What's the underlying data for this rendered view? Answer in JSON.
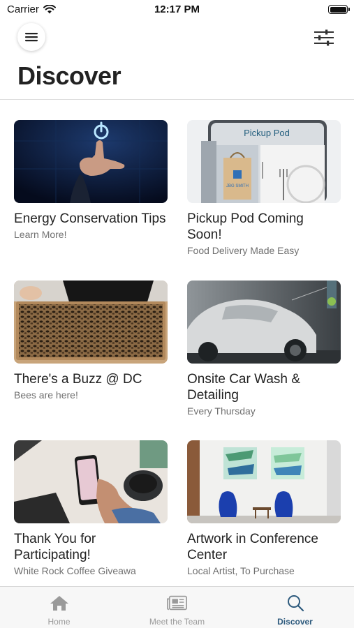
{
  "status_bar": {
    "carrier": "Carrier",
    "time": "12:17 PM"
  },
  "header": {
    "title": "Discover",
    "menu_icon": "hamburger-menu-icon",
    "filter_icon": "sliders-icon"
  },
  "cards": [
    {
      "title": "Energy Conservation Tips",
      "subtitle": "Learn More!",
      "image": "hand-touching-power-button"
    },
    {
      "title": "Pickup Pod Coming Soon!",
      "subtitle": "Food Delivery Made Easy",
      "image": "pickup-pod-locker",
      "image_text": {
        "sign": "Pickup Pod",
        "bag": "JBG SMITH"
      }
    },
    {
      "title": "There's a Buzz @ DC",
      "subtitle": "Bees are here!",
      "image": "beehive-frame"
    },
    {
      "title": "Onsite Car Wash & Detailing",
      "subtitle": "Every Thursday",
      "image": "foam-covered-car"
    },
    {
      "title": "Thank You for Participating!",
      "subtitle": "White Rock Coffee Giveawa",
      "image": "phone-and-coffee"
    },
    {
      "title": "Artwork in Conference Center",
      "subtitle": "Local Artist, To Purchase",
      "image": "gallery-blue-chairs"
    }
  ],
  "tab_bar": {
    "tabs": [
      {
        "label": "Home",
        "icon": "home-icon",
        "active": false
      },
      {
        "label": "Meet the Team",
        "icon": "newspaper-icon",
        "active": false
      },
      {
        "label": "Discover",
        "icon": "search-icon",
        "active": true
      }
    ]
  },
  "colors": {
    "accent": "#2d5a7d",
    "inactive_tab": "#9a9a9a",
    "subtitle": "#707070"
  }
}
